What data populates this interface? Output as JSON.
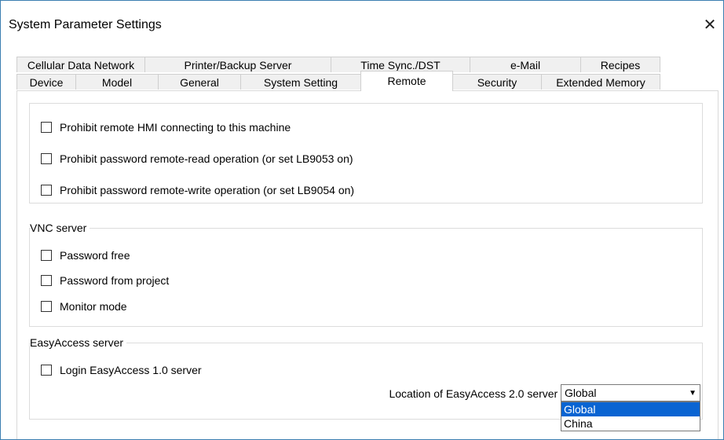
{
  "window": {
    "title": "System Parameter Settings",
    "close_glyph": "✕"
  },
  "tabs": {
    "back_row": [
      {
        "label": "Cellular Data Network"
      },
      {
        "label": "Printer/Backup Server"
      },
      {
        "label": "Time Sync./DST"
      },
      {
        "label": "e-Mail"
      },
      {
        "label": "Recipes"
      }
    ],
    "front_row": [
      {
        "label": "Device"
      },
      {
        "label": "Model"
      },
      {
        "label": "General"
      },
      {
        "label": "System Setting"
      },
      {
        "label": "Remote",
        "active": true
      },
      {
        "label": "Security"
      },
      {
        "label": "Extended Memory"
      }
    ]
  },
  "remote": {
    "options": [
      {
        "label": "Prohibit remote HMI connecting to this machine",
        "checked": false
      },
      {
        "label": "Prohibit password remote-read operation (or set LB9053 on)",
        "checked": false
      },
      {
        "label": "Prohibit password remote-write operation (or set LB9054 on)",
        "checked": false
      }
    ]
  },
  "vnc": {
    "legend": "VNC server",
    "options": [
      {
        "label": "Password free",
        "checked": false
      },
      {
        "label": "Password from project",
        "checked": false
      },
      {
        "label": "Monitor mode",
        "checked": false
      }
    ]
  },
  "easyaccess": {
    "legend": "EasyAccess server",
    "login_label": "Login EasyAccess 1.0 server",
    "login_checked": false,
    "location_label": "Location of EasyAccess 2.0 server :",
    "location_value": "Global",
    "dropdown_arrow": "▼",
    "location_options": [
      "Global",
      "China"
    ]
  }
}
